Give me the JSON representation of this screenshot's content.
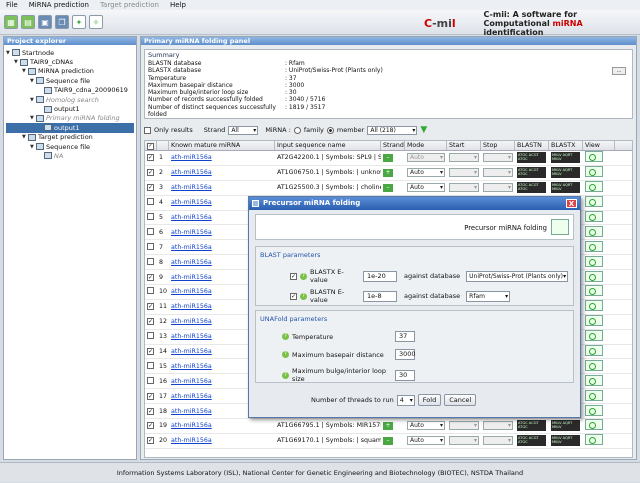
{
  "menu": [
    "File",
    "MiRNA prediction",
    "Target prediction",
    "Help"
  ],
  "logo": {
    "mark_left": "C",
    "mark_mid": "-mi",
    "mark_right": "l",
    "title_a": "C-mii: A software for",
    "title_b_pre": "Computational ",
    "title_b_mi": "miRNA",
    "title_b_post": " identification"
  },
  "project_explorer": {
    "title": "Project explorer",
    "nodes": [
      {
        "label": "Startnode"
      },
      {
        "label": "TAIR9_cDNAs"
      },
      {
        "label": "MiRNA prediction"
      },
      {
        "label": "Sequence file"
      },
      {
        "label": "TAIR9_cdna_20090619"
      },
      {
        "label": "Homolog search"
      },
      {
        "label": "output1"
      },
      {
        "label": "Primary miRNA folding"
      },
      {
        "label": "output1"
      },
      {
        "label": "Target prediction"
      },
      {
        "label": "Sequence file"
      },
      {
        "label": "NA"
      }
    ]
  },
  "main_panel_title": "Primary miRNA folding panel",
  "summary": {
    "heading": "Summary",
    "rows": [
      {
        "k": "BLASTN database",
        "v": ": Rfam"
      },
      {
        "k": "BLASTX database",
        "v": ": UniProt/Swiss-Prot (Plants only)"
      },
      {
        "k": "Temperature",
        "v": ": 37"
      },
      {
        "k": "Maximum basepair distance",
        "v": ": 3000"
      },
      {
        "k": "Maximum bulge/interior loop size",
        "v": ": 30"
      },
      {
        "k": "Number of records successfully folded",
        "v": ": 3040 / 5716"
      },
      {
        "k": "Number of distinct sequences successfully folded",
        "v": ": 1819 / 3517"
      }
    ],
    "more": "..."
  },
  "filter": {
    "only_results": "Only results",
    "strand_label": "Strand",
    "strand_value": "All",
    "mirna_label": "MiRNA :",
    "family": "family",
    "member": "member",
    "member_value": "All (218)"
  },
  "table": {
    "headers": [
      "",
      "",
      "Known mature miRNA",
      "Input sequence name",
      "Strand",
      "Mode",
      "Start",
      "Stop",
      "BLASTN",
      "BLASTX",
      "View"
    ],
    "rows": [
      {
        "n": "1",
        "mir": "ath-miR156a",
        "seq": "AT2G42200.1 | Symbols: SPL9 | SPL...",
        "strand": "minus",
        "mode": "Auto",
        "mode_disabled": true,
        "checked": true
      },
      {
        "n": "2",
        "mir": "ath-miR156a",
        "seq": "AT1G06750.1 | Symbols: | unknown ...",
        "strand": "plus",
        "mode": "Auto",
        "mode_disabled": false,
        "checked": true
      },
      {
        "n": "3",
        "mir": "ath-miR156a",
        "seq": "AT1G25500.3 | Symbols: | choline tra...",
        "strand": "minus",
        "mode": "Auto",
        "mode_disabled": false,
        "checked": true
      },
      {
        "n": "4",
        "mir": "ath-miR156a",
        "seq": "",
        "strand": "",
        "mode": "",
        "mode_disabled": false,
        "checked": false
      },
      {
        "n": "5",
        "mir": "ath-miR156a",
        "seq": "",
        "strand": "",
        "mode": "",
        "mode_disabled": false,
        "checked": false
      },
      {
        "n": "6",
        "mir": "ath-miR156a",
        "seq": "",
        "strand": "",
        "mode": "",
        "mode_disabled": false,
        "checked": false
      },
      {
        "n": "7",
        "mir": "ath-miR156a",
        "seq": "",
        "strand": "",
        "mode": "",
        "mode_disabled": false,
        "checked": false
      },
      {
        "n": "8",
        "mir": "ath-miR156a",
        "seq": "",
        "strand": "",
        "mode": "",
        "mode_disabled": false,
        "checked": false
      },
      {
        "n": "9",
        "mir": "ath-miR156a",
        "seq": "",
        "strand": "",
        "mode": "",
        "mode_disabled": false,
        "checked": true
      },
      {
        "n": "10",
        "mir": "ath-miR156a",
        "seq": "",
        "strand": "",
        "mode": "",
        "mode_disabled": false,
        "checked": false
      },
      {
        "n": "11",
        "mir": "ath-miR156a",
        "seq": "",
        "strand": "",
        "mode": "",
        "mode_disabled": false,
        "checked": true
      },
      {
        "n": "12",
        "mir": "ath-miR156a",
        "seq": "",
        "strand": "",
        "mode": "",
        "mode_disabled": false,
        "checked": true
      },
      {
        "n": "13",
        "mir": "ath-miR156a",
        "seq": "",
        "strand": "",
        "mode": "",
        "mode_disabled": false,
        "checked": false
      },
      {
        "n": "14",
        "mir": "ath-miR156a",
        "seq": "",
        "strand": "",
        "mode": "",
        "mode_disabled": false,
        "checked": true
      },
      {
        "n": "15",
        "mir": "ath-miR156a",
        "seq": "",
        "strand": "",
        "mode": "",
        "mode_disabled": false,
        "checked": false
      },
      {
        "n": "16",
        "mir": "ath-miR156a",
        "seq": "",
        "strand": "",
        "mode": "",
        "mode_disabled": false,
        "checked": false
      },
      {
        "n": "17",
        "mir": "ath-miR156a",
        "seq": "",
        "strand": "",
        "mode": "",
        "mode_disabled": false,
        "checked": true
      },
      {
        "n": "18",
        "mir": "ath-miR156a",
        "seq": "",
        "strand": "",
        "mode": "",
        "mode_disabled": false,
        "checked": true
      },
      {
        "n": "19",
        "mir": "ath-miR156a",
        "seq": "AT1G66795.1 | Symbols: MIR157B | ...",
        "strand": "plus",
        "mode": "Auto",
        "mode_disabled": false,
        "checked": true
      },
      {
        "n": "20",
        "mir": "ath-miR156a",
        "seq": "AT1G69170.1 | Symbols: | squamos...",
        "strand": "minus",
        "mode": "Auto",
        "mode_disabled": false,
        "checked": true
      }
    ]
  },
  "status_bar": "Information Systems Laboratory (ISL), National Center for Genetic Engineering and Biotechnology (BIOTEC), NSTDA Thailand",
  "dialog": {
    "title": "Precursor miRNA folding",
    "header_label": "Precursor miRNA folding",
    "close": "X",
    "blast": {
      "title": "BLAST parameters",
      "blastx_label": "BLASTX  E-value",
      "blastx_value": "1e-20",
      "blastx_db_label": "against database",
      "blastx_db": "UniProt/Swiss-Prot (Plants only)",
      "blastn_label": "BLASTN  E-value",
      "blastn_value": "1e-8",
      "blastn_db_label": "against database",
      "blastn_db": "Rfam"
    },
    "unafold": {
      "title": "UNAFold parameters",
      "temp_label": "Temperature",
      "temp_value": "37",
      "bp_label": "Maximum basepair distance",
      "bp_value": "3000",
      "loop_label": "Maximum bulge/interior loop size",
      "loop_value": "30"
    },
    "threads_label": "Number of threads to run",
    "threads_value": "4",
    "fold_button": "Fold",
    "cancel_button": "Cancel"
  }
}
